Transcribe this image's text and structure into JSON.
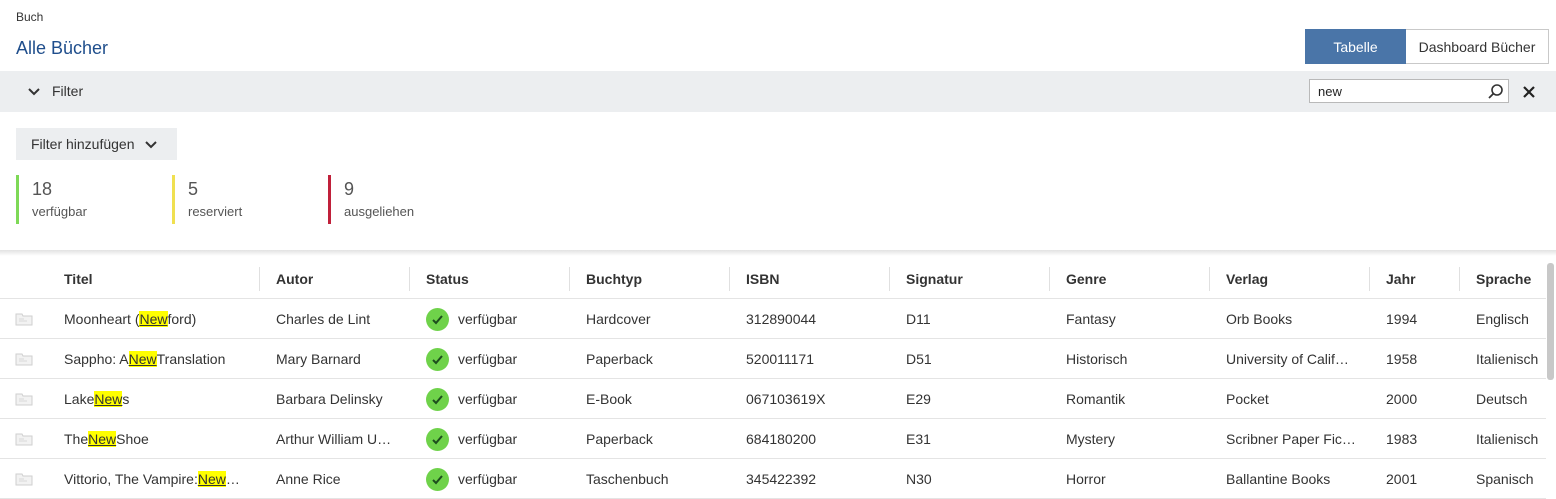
{
  "breadcrumb": "Buch",
  "page_title": "Alle Bücher",
  "view_switch": {
    "table_label": "Tabelle",
    "dashboard_label": "Dashboard Bücher"
  },
  "filter_bar": {
    "toggle_label": "Filter",
    "search_value": "new"
  },
  "add_filter_label": "Filter hinzufügen",
  "stats": [
    {
      "count": "18",
      "label": "verfügbar",
      "color": "#7ed957"
    },
    {
      "count": "5",
      "label": "reserviert",
      "color": "#f0e050"
    },
    {
      "count": "9",
      "label": "ausgeliehen",
      "color": "#c0203a"
    }
  ],
  "table": {
    "columns": [
      "Titel",
      "Autor",
      "Status",
      "Buchtyp",
      "ISBN",
      "Signatur",
      "Genre",
      "Verlag",
      "Jahr",
      "Sprache"
    ],
    "rows": [
      {
        "title_pre": "Moonheart (",
        "title_hl": "New",
        "title_post": "ford)",
        "author": "Charles de Lint",
        "status": "verfügbar",
        "type": "Hardcover",
        "isbn": "312890044",
        "signatur": "D11",
        "genre": "Fantasy",
        "verlag": "Orb Books",
        "jahr": "1994",
        "sprache": "Englisch"
      },
      {
        "title_pre": "Sappho: A ",
        "title_hl": "New",
        "title_post": " Translation",
        "author": "Mary Barnard",
        "status": "verfügbar",
        "type": "Paperback",
        "isbn": "520011171",
        "signatur": "D51",
        "genre": "Historisch",
        "verlag": "University of Calif…",
        "jahr": "1958",
        "sprache": "Italienisch"
      },
      {
        "title_pre": "Lake ",
        "title_hl": "New",
        "title_post": "s",
        "author": "Barbara Delinsky",
        "status": "verfügbar",
        "type": "E-Book",
        "isbn": "067103619X",
        "signatur": "E29",
        "genre": "Romantik",
        "verlag": "Pocket",
        "jahr": "2000",
        "sprache": "Deutsch"
      },
      {
        "title_pre": "The ",
        "title_hl": "New",
        "title_post": " Shoe",
        "author": "Arthur William U…",
        "status": "verfügbar",
        "type": "Paperback",
        "isbn": "684180200",
        "signatur": "E31",
        "genre": "Mystery",
        "verlag": "Scribner Paper Fic…",
        "jahr": "1983",
        "sprache": "Italienisch"
      },
      {
        "title_pre": "Vittorio, The Vampire: ",
        "title_hl": "New",
        "title_post": "…",
        "author": "Anne Rice",
        "status": "verfügbar",
        "type": "Taschenbuch",
        "isbn": "345422392",
        "signatur": "N30",
        "genre": "Horror",
        "verlag": "Ballantine Books",
        "jahr": "2001",
        "sprache": "Spanisch"
      }
    ]
  },
  "colors": {
    "accent": "#4a75a8",
    "title": "#1f4e8c",
    "status_ok": "#6fd24a",
    "highlight": "#ffff00"
  }
}
